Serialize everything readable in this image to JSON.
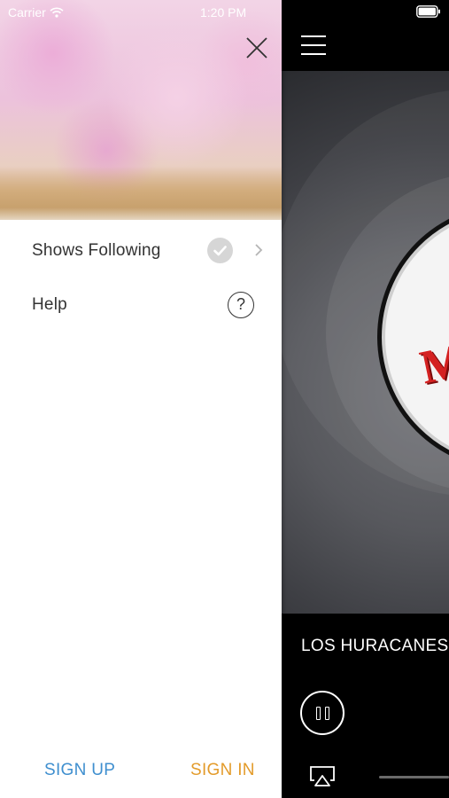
{
  "status_bar": {
    "carrier": "Carrier",
    "time": "1:20 PM"
  },
  "drawer": {
    "menu_items": [
      {
        "label": "Shows Following",
        "icon": "check-circle-icon",
        "accessory": "chevron-right-icon"
      },
      {
        "label": "Help",
        "icon": "question-circle-icon"
      }
    ],
    "sign_up_label": "SIGN UP",
    "sign_in_label": "SIGN IN",
    "colors": {
      "sign_up": "#3f8fcf",
      "sign_in": "#e39b2a"
    }
  },
  "player": {
    "track_title": "LOS HURACANES DEL NORTE",
    "logo_text": "M",
    "state": "playing"
  }
}
